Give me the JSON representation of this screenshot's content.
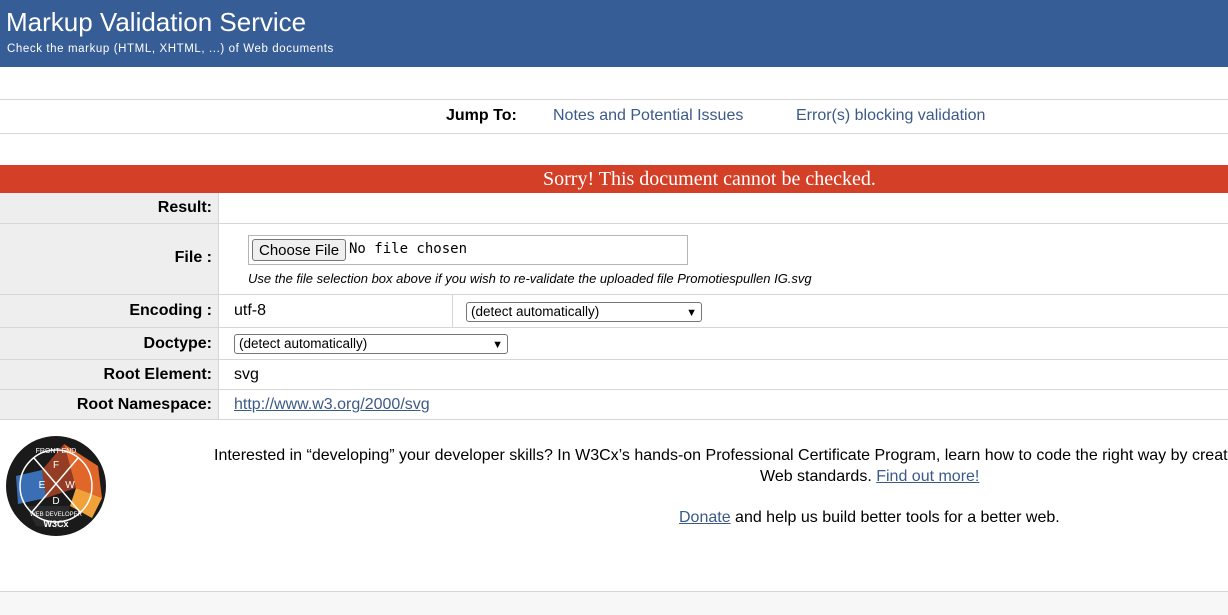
{
  "header": {
    "title": "Markup Validation Service",
    "subtitle": "Check the markup (HTML, XHTML, ...) of Web documents"
  },
  "jump": {
    "label": "Jump To:",
    "links": [
      "Notes and Potential Issues",
      "Error(s) blocking validation"
    ]
  },
  "banner": {
    "text": "Sorry! This document cannot be checked."
  },
  "rows": {
    "result": {
      "label": "Result:",
      "value": ""
    },
    "file": {
      "label": "File :",
      "button": "Choose File",
      "status": "No file chosen",
      "note": "Use the file selection box above if you wish to re-validate the uploaded file Promotiespullen IG.svg"
    },
    "encoding": {
      "label": "Encoding :",
      "value": "utf-8",
      "select": "(detect automatically)"
    },
    "doctype": {
      "label": "Doctype:",
      "select": "(detect automatically)"
    },
    "root_element": {
      "label": "Root Element:",
      "value": "svg"
    },
    "root_namespace": {
      "label": "Root Namespace:",
      "value": "http://www.w3.org/2000/svg"
    }
  },
  "promo": {
    "line1": "Interested in “developing” your developer skills? In W3Cx’s hands-on Professional Certificate Program, learn how to code the right way by creat",
    "line2_prefix": "Web standards. ",
    "line2_link": "Find out more!",
    "donate_link": "Donate",
    "donate_suffix": " and help us build better tools for a better web.",
    "badge": {
      "icon": "w3cx-front-end-web-developer-badge",
      "top_text": "FRONT END",
      "bottom_text": "WEB DEVELOPER",
      "letters": [
        "F",
        "E",
        "W",
        "D"
      ],
      "brand": "W3Cx"
    }
  },
  "colors": {
    "header_bg": "#365d95",
    "banner_bg": "#d43f27",
    "link": "#3b5a87",
    "label_bg": "#eeeeee"
  }
}
